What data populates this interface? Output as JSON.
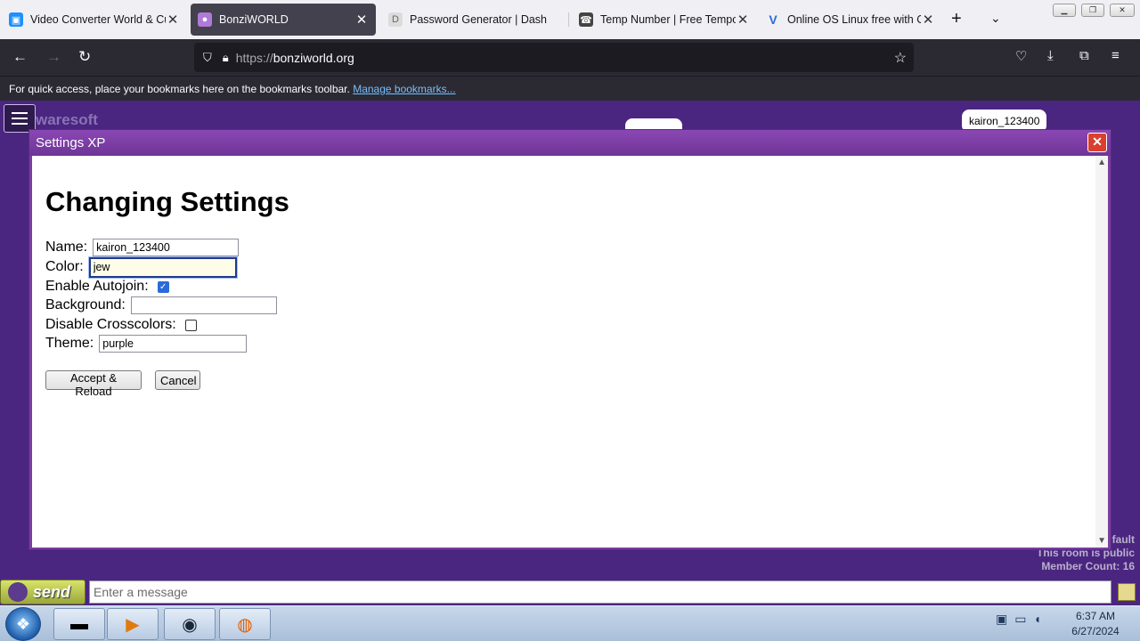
{
  "browser": {
    "tabs": [
      {
        "title": "Video Converter World & Cu",
        "icon": "video-converter-icon",
        "icon_color": "#1e90ff",
        "active": false
      },
      {
        "title": "BonziWORLD",
        "icon": "bonzi-icon",
        "icon_color": "#b07ad8",
        "active": true
      },
      {
        "title": "Password Generator | Dash",
        "icon": "password-generator-icon",
        "icon_color": "#cccccc",
        "active": false
      },
      {
        "title": "Temp Number | Free Tempor",
        "icon": "temp-number-icon",
        "icon_color": "#444444",
        "active": false
      },
      {
        "title": "Online OS Linux free with On",
        "icon": "linux-os-icon",
        "icon_color": "#2a6bd8",
        "active": false
      }
    ],
    "url_scheme": "https://",
    "url_host": "bonziworld.org",
    "bookmarks_hint": "For quick access, place your bookmarks here on the bookmarks toolbar.",
    "bookmarks_link": "Manage bookmarks..."
  },
  "page": {
    "watermark": "waresoft",
    "user_bubble": "kairon_123400",
    "room_info": [
      "fault",
      "This room is public",
      "Member Count: 16"
    ]
  },
  "dialog": {
    "title": "Settings XP",
    "heading": "Changing Settings",
    "name_label": "Name:",
    "name_value": "kairon_123400",
    "color_label": "Color:",
    "color_value": "jew",
    "autojoin_label": "Enable Autojoin:",
    "autojoin_checked": true,
    "background_label": "Background:",
    "background_value": "",
    "crosscolors_label": "Disable Crosscolors:",
    "crosscolors_checked": false,
    "theme_label": "Theme:",
    "theme_value": "purple",
    "accept_label": "Accept & Reload",
    "cancel_label": "Cancel"
  },
  "chat": {
    "send_label": "send",
    "placeholder": "Enter a message"
  },
  "taskbar": {
    "apps": [
      "terminal-icon",
      "media-player-icon",
      "steam-icon",
      "firefox-icon"
    ],
    "time": "6:37 AM",
    "date": "6/27/2024"
  }
}
